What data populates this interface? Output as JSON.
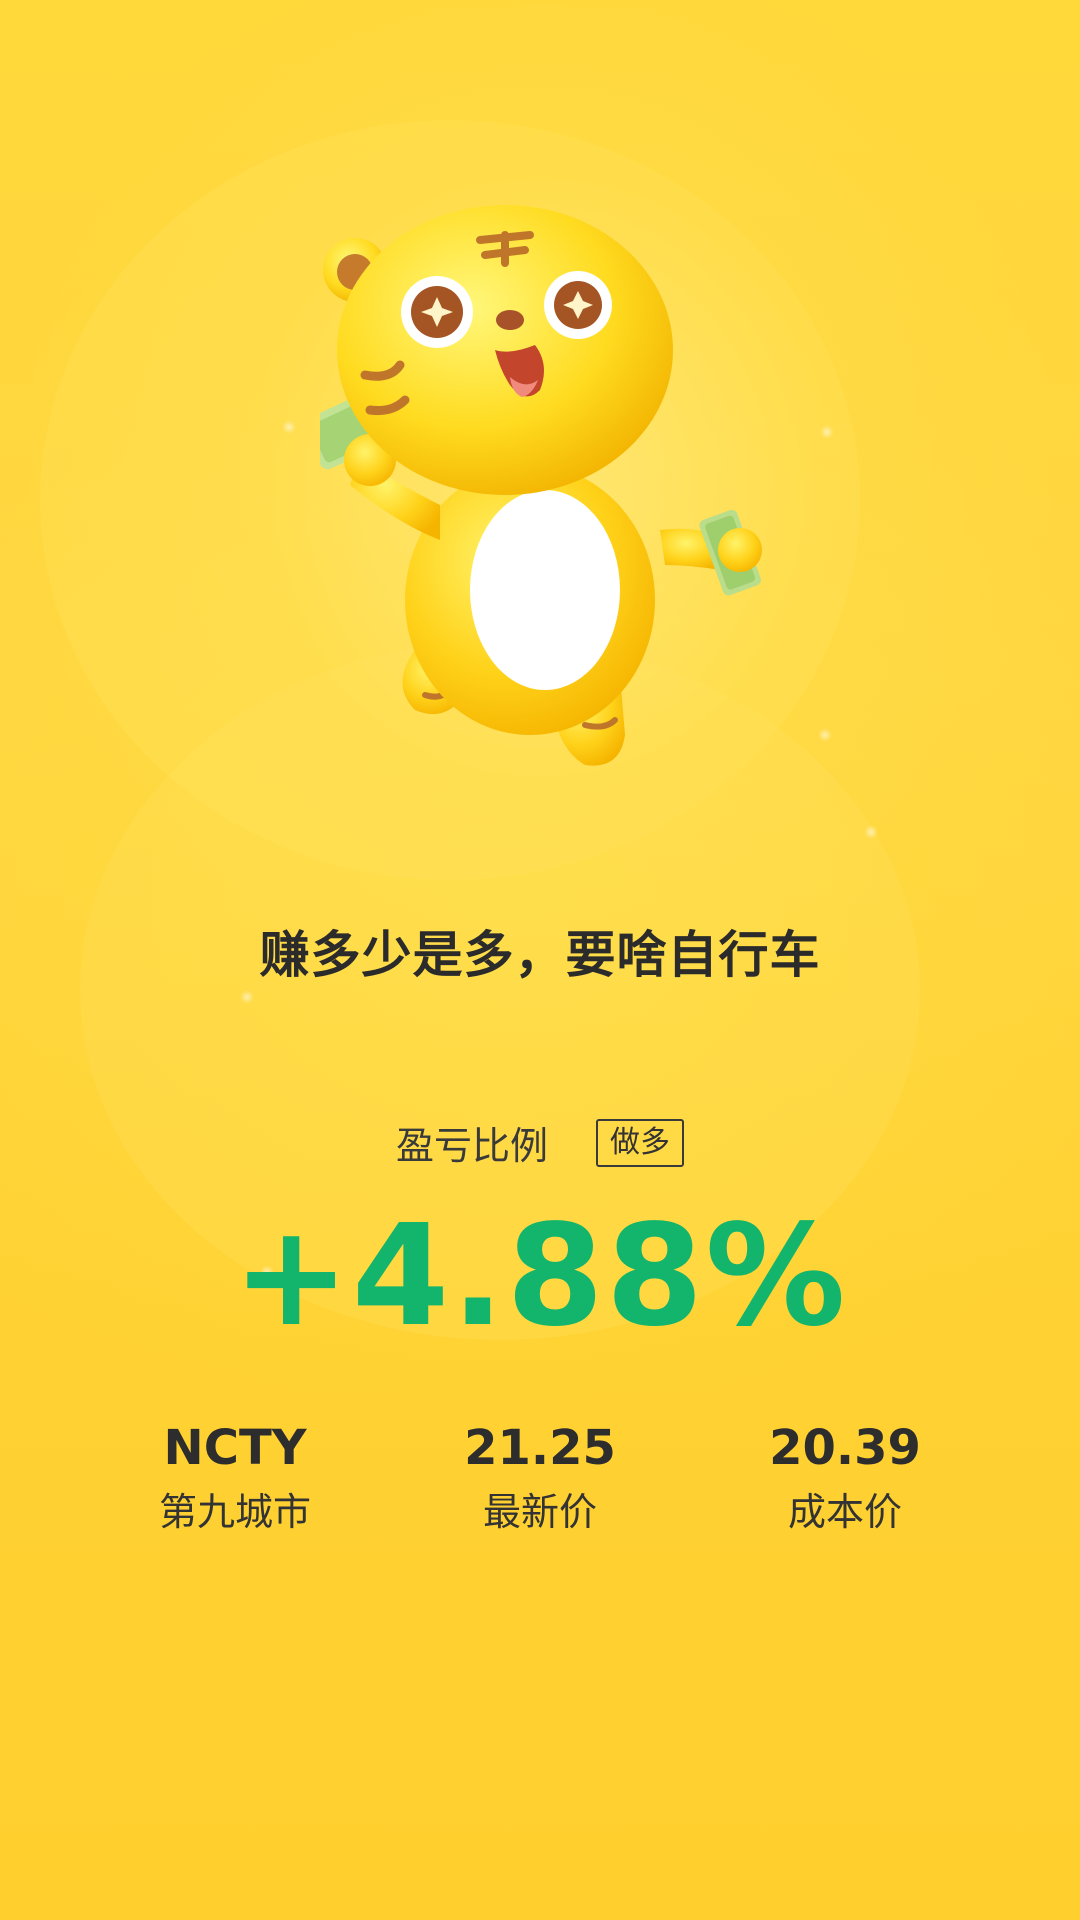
{
  "slogan": "赚多少是多，要啥自行车",
  "ratio": {
    "label": "盈亏比例",
    "direction": "做多",
    "value": "+4.88%",
    "color": "#12b56b"
  },
  "stats": [
    {
      "value": "NCTY",
      "label": "第九城市"
    },
    {
      "value": "21.25",
      "label": "最新价"
    },
    {
      "value": "20.39",
      "label": "成本价"
    }
  ],
  "mascot": {
    "icon": "tiger-mascot-icon"
  },
  "colors": {
    "background": "#ffd83a",
    "text": "#2b2b2b",
    "profit": "#12b56b"
  }
}
